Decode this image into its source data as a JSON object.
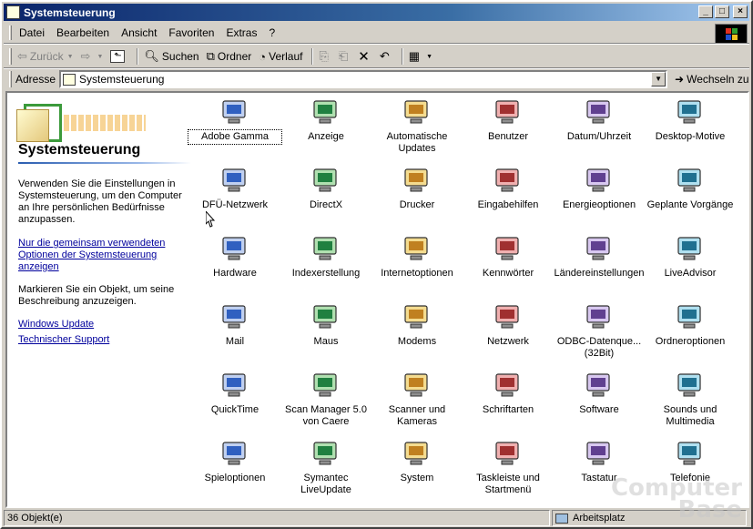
{
  "window": {
    "title": "Systemsteuerung"
  },
  "menu": [
    {
      "label": "Datei",
      "key": "D"
    },
    {
      "label": "Bearbeiten",
      "key": "B"
    },
    {
      "label": "Ansicht",
      "key": "A"
    },
    {
      "label": "Favoriten",
      "key": "F"
    },
    {
      "label": "Extras",
      "key": "x"
    },
    {
      "label": "?",
      "key": "?"
    }
  ],
  "toolbar": {
    "back": "Zurück",
    "search": "Suchen",
    "folders": "Ordner",
    "history": "Verlauf"
  },
  "address": {
    "label": "Adresse",
    "value": "Systemsteuerung",
    "go": "Wechseln zu"
  },
  "left_panel": {
    "title": "Systemsteuerung",
    "intro": "Verwenden Sie die Einstellungen in Systemsteuerung, um den Computer an Ihre persönlichen Bedürfnisse anzupassen.",
    "link_common": "Nur die gemeinsam verwendeten Optionen der Systemsteuerung anzeigen",
    "hint": "Markieren Sie ein Objekt, um seine Beschreibung anzuzeigen.",
    "link_update": "Windows Update",
    "link_support": "Technischer Support"
  },
  "items": [
    {
      "label": "Adobe Gamma",
      "icon": "monitor-gamma-icon"
    },
    {
      "label": "Anzeige",
      "icon": "display-icon"
    },
    {
      "label": "Automatische Updates",
      "icon": "globe-update-icon"
    },
    {
      "label": "Benutzer",
      "icon": "users-icon"
    },
    {
      "label": "Datum/Uhrzeit",
      "icon": "calendar-clock-icon"
    },
    {
      "label": "Desktop-Motive",
      "icon": "desktop-themes-icon"
    },
    {
      "label": "DFÜ-Netzwerk",
      "icon": "dialup-folder-icon"
    },
    {
      "label": "DirectX",
      "icon": "directx-icon"
    },
    {
      "label": "Drucker",
      "icon": "printer-folder-icon"
    },
    {
      "label": "Eingabehilfen",
      "icon": "accessibility-icon"
    },
    {
      "label": "Energieoptionen",
      "icon": "power-plug-icon"
    },
    {
      "label": "Geplante Vorgänge",
      "icon": "scheduled-tasks-icon"
    },
    {
      "label": "Hardware",
      "icon": "hardware-icon"
    },
    {
      "label": "Indexerstellung",
      "icon": "binoculars-icon"
    },
    {
      "label": "Internetoptionen",
      "icon": "internet-options-icon"
    },
    {
      "label": "Kennwörter",
      "icon": "keys-icon"
    },
    {
      "label": "Ländereinstellungen",
      "icon": "globe-icon"
    },
    {
      "label": "LiveAdvisor",
      "icon": "liveadvisor-icon"
    },
    {
      "label": "Mail",
      "icon": "mail-icon"
    },
    {
      "label": "Maus",
      "icon": "mouse-icon"
    },
    {
      "label": "Modems",
      "icon": "modem-phone-icon"
    },
    {
      "label": "Netzwerk",
      "icon": "network-icon"
    },
    {
      "label": "ODBC-Datenque... (32Bit)",
      "icon": "odbc-icon"
    },
    {
      "label": "Ordneroptionen",
      "icon": "folder-options-icon"
    },
    {
      "label": "QuickTime",
      "icon": "quicktime-icon"
    },
    {
      "label": "Scan Manager 5.0 von Caere",
      "icon": "scanner-icon"
    },
    {
      "label": "Scanner und Kameras",
      "icon": "scanner-camera-icon"
    },
    {
      "label": "Schriftarten",
      "icon": "fonts-icon"
    },
    {
      "label": "Software",
      "icon": "software-icon"
    },
    {
      "label": "Sounds und Multimedia",
      "icon": "speaker-icon"
    },
    {
      "label": "Spieloptionen",
      "icon": "joystick-icon"
    },
    {
      "label": "Symantec LiveUpdate",
      "icon": "symantec-icon"
    },
    {
      "label": "System",
      "icon": "computer-icon"
    },
    {
      "label": "Taskleiste und Startmenü",
      "icon": "taskbar-icon"
    },
    {
      "label": "Tastatur",
      "icon": "keyboard-icon"
    },
    {
      "label": "Telefonie",
      "icon": "telephony-icon"
    }
  ],
  "status": {
    "count": "36 Objekt(e)",
    "zone": "Arbeitsplatz"
  },
  "watermark": [
    "Computer",
    "Base"
  ],
  "colors": {
    "titlebar_start": "#0a246a",
    "titlebar_end": "#a6caf0",
    "link": "#00009c",
    "chrome": "#d4d0c8"
  }
}
